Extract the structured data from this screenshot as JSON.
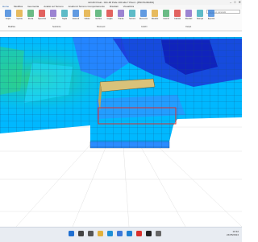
{
  "window": {
    "title": "dvCAD Float - 041-48 Pelle 100 alla 7 Piso4 - [BSOSURAM3]",
    "controls": [
      "–",
      "□",
      "✕"
    ]
  },
  "ribbon": {
    "tabs": [
      "Home",
      "Modifica",
      "Geometria",
      "Analisi sul Terreno",
      "Analisi di Terreno Comportamento",
      "Risultati",
      "Visualizza"
    ],
    "tools": [
      {
        "label": "Copia",
        "icon": "copy-icon"
      },
      {
        "label": "Sposta",
        "icon": "move-icon"
      },
      {
        "label": "Ruota",
        "icon": "rotate-icon"
      },
      {
        "label": "Specchia",
        "icon": "mirror-icon"
      },
      {
        "label": "Scala",
        "icon": "scale-icon"
      },
      {
        "label": "Taglia",
        "icon": "trim-icon"
      },
      {
        "label": "Estendi",
        "icon": "extend-icon"
      },
      {
        "label": "Solaio",
        "icon": "slab-icon"
      },
      {
        "label": "Verifica",
        "icon": "check-icon"
      },
      {
        "label": "Griglia",
        "icon": "grid-icon"
      },
      {
        "label": "Pianta",
        "icon": "plan-icon"
      },
      {
        "label": "Sezioni",
        "icon": "section-icon"
      },
      {
        "label": "Elemento",
        "icon": "element-icon"
      },
      {
        "label": "Modello",
        "icon": "model-icon"
      },
      {
        "label": "Carichi",
        "icon": "loads-icon"
      },
      {
        "label": "Calcola",
        "icon": "calculate-icon"
      },
      {
        "label": "Risultati",
        "icon": "results-icon"
      },
      {
        "label": "Stampa",
        "icon": "print-icon"
      },
      {
        "label": "Esporta",
        "icon": "export-icon"
      }
    ],
    "groups": [
      "Modifica",
      "Selezione",
      "Strumenti",
      "Carichi",
      "Output"
    ],
    "search_placeholder": "Cerca un comando"
  },
  "colors": {
    "accent": "#1f5aa6",
    "selection_box": "#d9302c",
    "contour_low": "#00c8ff",
    "contour_mid": "#2a7bff",
    "contour_high": "#1b2fd6",
    "contour_green": "#33d17a",
    "wall_yellow": "#d9c27a"
  },
  "taskbar": {
    "apps": [
      "start-icon",
      "search-icon",
      "task-view-icon",
      "explorer-icon",
      "edge-icon",
      "store-icon",
      "mail-icon",
      "cad-app-icon",
      "terminal-icon",
      "settings-icon"
    ],
    "time": "10:32",
    "date": "24/05/2024"
  }
}
